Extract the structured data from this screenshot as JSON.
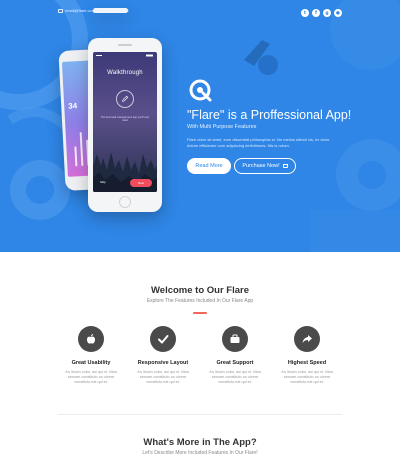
{
  "colors": {
    "hero": "#2f86e6",
    "accent": "#f2665a",
    "icon_circle": "#4a4a4a",
    "next_button": "#f24c5d"
  },
  "topbar": {
    "email": "email@flare.com",
    "phone": "+1(012)4567890"
  },
  "socials": [
    {
      "icon": "twitter-icon",
      "glyph": "t"
    },
    {
      "icon": "facebook-icon",
      "glyph": "f"
    },
    {
      "icon": "google-plus-icon",
      "glyph": "g"
    },
    {
      "icon": "dribbble-icon",
      "glyph": "●"
    }
  ],
  "phone": {
    "walkthrough_title": "Walkthrough",
    "walkthrough_text": "The best task management app you'll ever need",
    "skip": "Skip",
    "next": "Next",
    "back_number": "34"
  },
  "hero": {
    "title": "\"Flare\" is a Proffessional App!",
    "subtitle": "With Multi Purpose Features",
    "body": "Flare dolor sit amet, eum dissentiat philosophia ei. No melius siticsit vis, ex dolor dolore efficiantur cum adipiscing definitiones. Nis is rutum.",
    "read_more": "Read More",
    "purchase": "Purchase Now!"
  },
  "welcome": {
    "title": "Welcome to Our Flare",
    "subtitle": "Explore The Features Included In Our Flare App"
  },
  "features": [
    {
      "icon": "apple-icon",
      "title": "Great Usability",
      "desc": "An ilucim cobu, dui qui ei. Mea semam constituto no vivere constituto est qui et."
    },
    {
      "icon": "checkmark-icon",
      "title": "Responsive Layout",
      "desc": "An ilucim cobu, dui qui ei. Mea semam constituto no vivere constituto est qui et."
    },
    {
      "icon": "briefcase-icon",
      "title": "Great Support",
      "desc": "An ilucim cobu, dui qui ei. Mea semam constituto no vivere constituto est qui et."
    },
    {
      "icon": "share-arrow-icon",
      "title": "Highest Speed",
      "desc": "An ilucim cobu, dui qui ei. Mea semam constituto no vivere constituto est qui et."
    }
  ],
  "more": {
    "title": "What's More in The App?",
    "subtitle": "Let's Describe More Included Features In Our Flare!"
  }
}
